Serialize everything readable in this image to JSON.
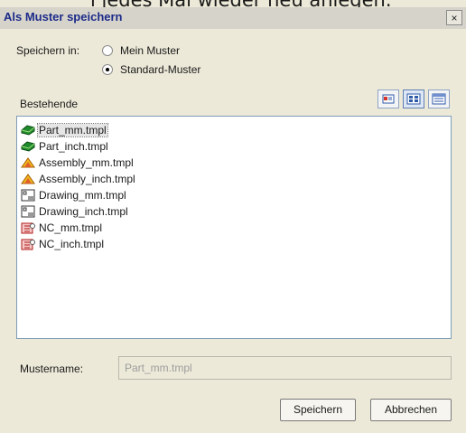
{
  "top_text": "i jedes Mal wieder neu anlegen.",
  "window": {
    "title": "Als Muster speichern",
    "close_label": "×"
  },
  "save_in": {
    "label": "Speichern in:",
    "options": [
      {
        "label": "Mein Muster",
        "selected": false
      },
      {
        "label": "Standard-Muster",
        "selected": true
      }
    ]
  },
  "existing": {
    "label": "Bestehende"
  },
  "view_buttons": [
    {
      "name": "view-details",
      "icon": "details-view-icon"
    },
    {
      "name": "view-large-icons",
      "icon": "large-icons-view-icon"
    },
    {
      "name": "view-list",
      "icon": "list-view-icon"
    }
  ],
  "files": [
    {
      "name": "Part_mm.tmpl",
      "icon": "part-icon",
      "selected": true
    },
    {
      "name": "Part_inch.tmpl",
      "icon": "part-icon",
      "selected": false
    },
    {
      "name": "Assembly_mm.tmpl",
      "icon": "assembly-icon",
      "selected": false
    },
    {
      "name": "Assembly_inch.tmpl",
      "icon": "assembly-icon",
      "selected": false
    },
    {
      "name": "Drawing_mm.tmpl",
      "icon": "drawing-icon",
      "selected": false
    },
    {
      "name": "Drawing_inch.tmpl",
      "icon": "drawing-icon",
      "selected": false
    },
    {
      "name": "NC_mm.tmpl",
      "icon": "nc-icon",
      "selected": false
    },
    {
      "name": "NC_inch.tmpl",
      "icon": "nc-icon",
      "selected": false
    }
  ],
  "template_name": {
    "label": "Mustername:",
    "value": "Part_mm.tmpl"
  },
  "buttons": {
    "save": "Speichern",
    "cancel": "Abbrechen"
  },
  "colors": {
    "title_text": "#1c2b8a",
    "dialog_bg": "#ece9d8",
    "list_border": "#7f9db9"
  }
}
